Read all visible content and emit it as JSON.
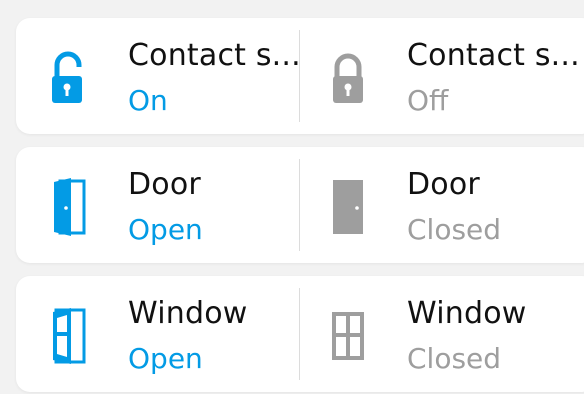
{
  "colors": {
    "active": "#039be5",
    "inactive": "#9e9e9e",
    "text": "#111111"
  },
  "rows": [
    {
      "left": {
        "name": "Contact s...",
        "state": "On",
        "icon": "lock-open-icon"
      },
      "right": {
        "name": "Contact s...",
        "state": "Off",
        "icon": "lock-closed-icon"
      }
    },
    {
      "left": {
        "name": "Door",
        "state": "Open",
        "icon": "door-open-icon"
      },
      "right": {
        "name": "Door",
        "state": "Closed",
        "icon": "door-closed-icon"
      }
    },
    {
      "left": {
        "name": "Window",
        "state": "Open",
        "icon": "window-open-icon"
      },
      "right": {
        "name": "Window",
        "state": "Closed",
        "icon": "window-closed-icon"
      }
    }
  ]
}
